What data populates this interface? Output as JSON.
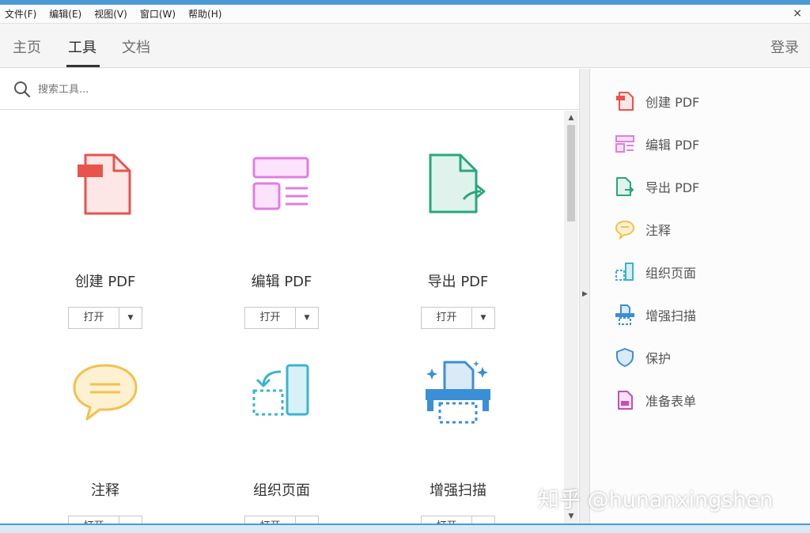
{
  "menu": {
    "items": [
      "文件(F)",
      "编辑(E)",
      "视图(V)",
      "窗口(W)",
      "帮助(H)"
    ],
    "close": "×"
  },
  "tabs": [
    {
      "label": "主页",
      "active": false
    },
    {
      "label": "工具",
      "active": true
    },
    {
      "label": "文档",
      "active": false
    }
  ],
  "header": {
    "login_label": "登录"
  },
  "search": {
    "placeholder": "搜索工具..."
  },
  "tools": [
    {
      "label": "创建 PDF",
      "open_label": "打开",
      "icon": "create-pdf-icon",
      "color": "#e8534e"
    },
    {
      "label": "编辑 PDF",
      "open_label": "打开",
      "icon": "edit-pdf-icon",
      "color": "#e07ee0"
    },
    {
      "label": "导出 PDF",
      "open_label": "打开",
      "icon": "export-pdf-icon",
      "color": "#2aa67e"
    },
    {
      "label": "注释",
      "open_label": "打开",
      "icon": "comment-icon",
      "color": "#f2c24e"
    },
    {
      "label": "组织页面",
      "open_label": "打开",
      "icon": "organize-pages-icon",
      "color": "#3bb3cf"
    },
    {
      "label": "增强扫描",
      "open_label": "打开",
      "icon": "enhance-scan-icon",
      "color": "#3b8fd6"
    }
  ],
  "sidebar": {
    "items": [
      {
        "label": "创建 PDF",
        "icon": "create-pdf-icon",
        "color": "#e8534e"
      },
      {
        "label": "编辑 PDF",
        "icon": "edit-pdf-icon",
        "color": "#e07ee0"
      },
      {
        "label": "导出 PDF",
        "icon": "export-pdf-icon",
        "color": "#2aa67e"
      },
      {
        "label": "注释",
        "icon": "comment-icon",
        "color": "#f2c24e"
      },
      {
        "label": "组织页面",
        "icon": "organize-pages-icon",
        "color": "#3bb3cf"
      },
      {
        "label": "增强扫描",
        "icon": "enhance-scan-icon",
        "color": "#3b8fd6"
      },
      {
        "label": "保护",
        "icon": "shield-icon",
        "color": "#3b8fd6"
      },
      {
        "label": "准备表单",
        "icon": "prepare-form-icon",
        "color": "#c44fb5"
      }
    ]
  },
  "watermark": "知乎 @hunanxingshen"
}
